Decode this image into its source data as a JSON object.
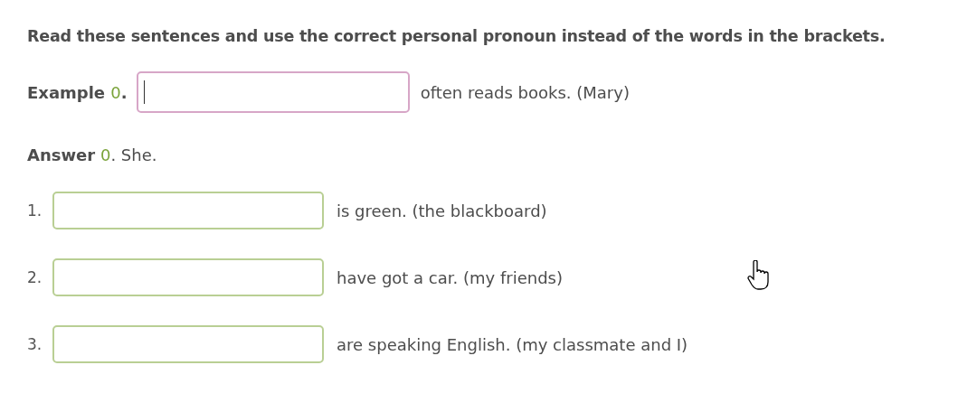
{
  "instruction": "Read these sentences and use the correct personal pronoun instead of the words in the brackets.",
  "example": {
    "label": "Example",
    "number": "0",
    "suffix": ".",
    "focused": true,
    "text": "often reads books. (Mary)"
  },
  "answer": {
    "label": "Answer",
    "number": "0",
    "suffix": ". She."
  },
  "items": [
    {
      "number": "1.",
      "text": "is green. (the blackboard)",
      "focused": false
    },
    {
      "number": "2.",
      "text": "have got a car. (my friends)",
      "focused": false
    },
    {
      "number": "3.",
      "text": "are speaking English. (my classmate and I)",
      "focused": false
    }
  ]
}
